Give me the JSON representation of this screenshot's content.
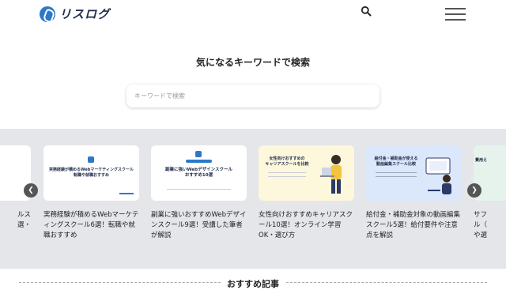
{
  "header": {
    "logo_text": "リスログ",
    "menu_icon": "hamburger-menu-icon"
  },
  "search": {
    "title": "気になるキーワードで検索",
    "placeholder": "キーワードで検索",
    "button_icon": "search-icon"
  },
  "carousel": {
    "prev_icon": "chevron-left-icon",
    "next_icon": "chevron-right-icon",
    "edge_left_title": "ルス\n選・",
    "cards": [
      {
        "thumb_text": "実務経験が積めるWebマーケティングスクール\n転職や就職おすすめ",
        "title": "実務経験が積めるWebマーケティングスクール6選！転職や就職おすすめ"
      },
      {
        "thumb_text": "副業に強いWebデザインスクール\nおすすめ10選",
        "title": "副業に強いおすすめWebデザインスクール9選！受講した筆者が解説"
      },
      {
        "thumb_text": "女性向けおすすめの\nキャリアスクールを比較",
        "title": "女性向けおすすめキャリアスクール10選！オンライン学習OK・選び方"
      },
      {
        "thumb_text": "給付金・補助金が使える\n動画編集スクール比較",
        "title": "給付金・補助金対象の動画編集スクール5選！給付要件や注意点を解説"
      }
    ],
    "edge_right_thumb": "費用え",
    "edge_right_title": "サフ\nル（\nや選"
  },
  "section": {
    "title": "おすすめ記事"
  },
  "colors": {
    "accent": "#2d78c8",
    "carousel_bg": "#e4e6ea"
  }
}
